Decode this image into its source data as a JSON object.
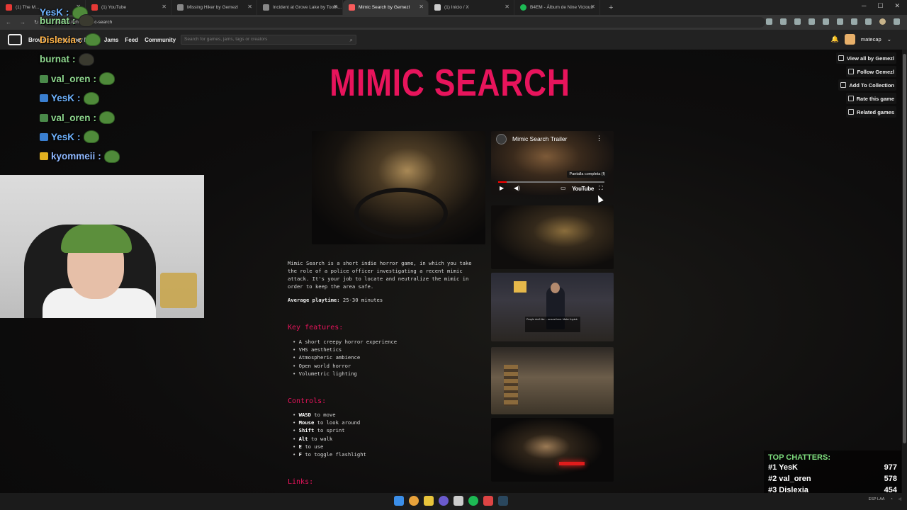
{
  "browser": {
    "tabs": [
      {
        "label": "(1) The M...",
        "color": "#e53935",
        "active": false
      },
      {
        "label": "(1) YouTube",
        "color": "#e53935",
        "active": false
      },
      {
        "label": "Missing Hiker by Gemezl",
        "color": "#888888",
        "active": false
      },
      {
        "label": "Incident at Grove Lake by Tooth...",
        "color": "#888888",
        "active": false
      },
      {
        "label": "Mimic Search by Gemezl",
        "color": "#fa5c5c",
        "active": true
      },
      {
        "label": "(1) Inicio / X",
        "color": "#cccccc",
        "active": false
      },
      {
        "label": "B4EM - Álbum de Nine Vicious",
        "color": "#1db954",
        "active": false
      }
    ],
    "new_tab": "+",
    "url": "gemezl.itch.io/mimic-search"
  },
  "itch_nav": {
    "links": [
      "Browse",
      "Developer Logs",
      "Jams",
      "Feed",
      "Community"
    ],
    "search_placeholder": "Search for games, jams, tags or creators",
    "username": "matecap"
  },
  "game": {
    "title": "MIMIC SEARCH",
    "actions": [
      "View all by Gemezl",
      "Follow Gemezl",
      "Add To Collection",
      "Rate this game",
      "Related games"
    ],
    "trailer_title": "Mimic Search Trailer",
    "fullscreen_tooltip": "Pantalla completa (f)",
    "youtube_label": "YouTube",
    "subtitle_text": "People don't like ... around here. Make it quick.",
    "description": "Mimic Search is a short indie horror game, in which you take the role of a police officer investigating a recent mimic attack. It's your job to locate and neutralize the mimic in order to keep the area safe.",
    "playtime_label": "Average playtime:",
    "playtime_value": "25-30 minutes",
    "features_heading": "Key features:",
    "features": [
      "A short creepy horror experience",
      "VHS aesthetics",
      "Atmospheric ambience",
      "Open world horror",
      "Volumetric lighting"
    ],
    "controls_heading": "Controls:",
    "controls": [
      {
        "key": "WASD",
        "action": "to move"
      },
      {
        "key": "Mouse",
        "action": "to look around"
      },
      {
        "key": "Shift",
        "action": "to sprint"
      },
      {
        "key": "Alt",
        "action": "to walk"
      },
      {
        "key": "E",
        "action": "to use"
      },
      {
        "key": "F",
        "action": "to toggle flashlight"
      }
    ],
    "links_heading": "Links:"
  },
  "stream_chat": [
    {
      "user": "YesK",
      "color": "#6fb3ff"
    },
    {
      "user": "burnat",
      "color": "#8fd88f"
    },
    {
      "user": "Dislexia",
      "color": "#ffb347"
    },
    {
      "user": "burnat",
      "color": "#8fd88f"
    },
    {
      "user": "val_oren",
      "color": "#8fd88f"
    },
    {
      "user": "YesK",
      "color": "#6fb3ff"
    },
    {
      "user": "val_oren",
      "color": "#8fd88f"
    },
    {
      "user": "YesK",
      "color": "#6fb3ff"
    },
    {
      "user": "kyommeii",
      "color": "#8fb8ff"
    }
  ],
  "top_chatters": {
    "heading": "TOP CHATTERS:",
    "rows": [
      {
        "rank": "#1 YesK",
        "count": "977"
      },
      {
        "rank": "#2 val_oren",
        "count": "578"
      },
      {
        "rank": "#3 Dislexia",
        "count": "454"
      }
    ]
  },
  "taskbar": {
    "lang": "ESP LAA"
  }
}
